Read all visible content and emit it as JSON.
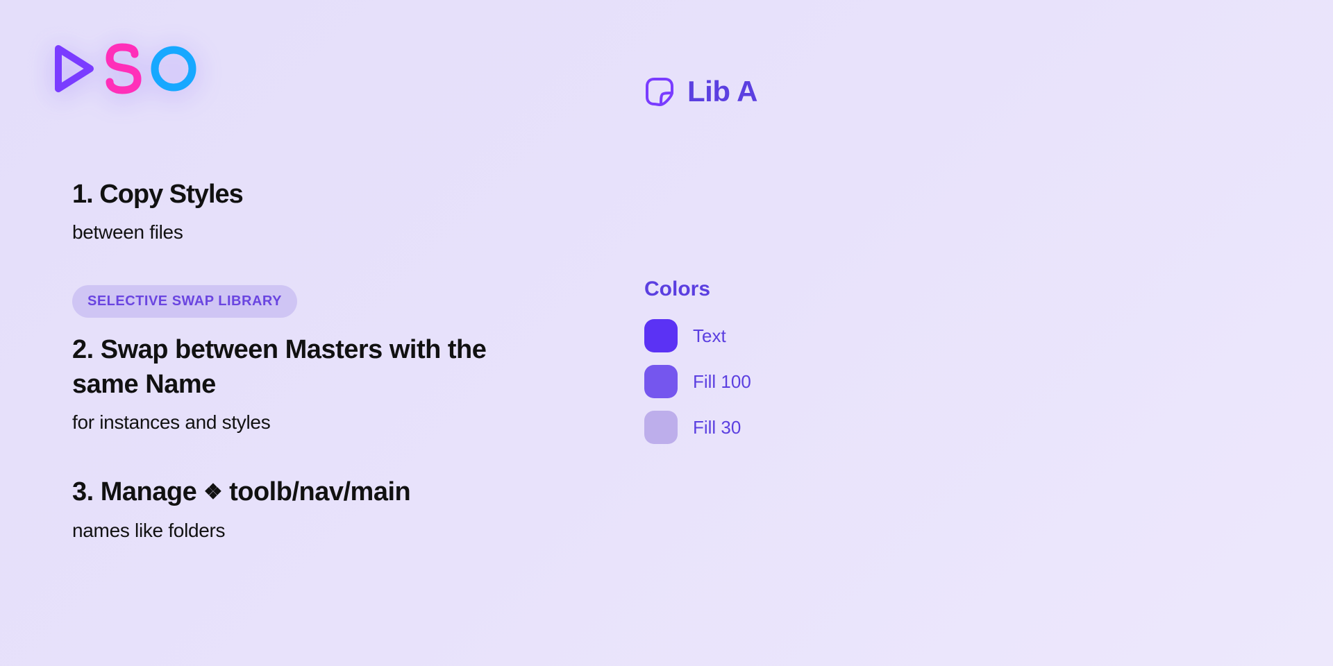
{
  "logo": {
    "name": "DSO"
  },
  "features": [
    {
      "title": "1. Copy Styles",
      "subtitle": "between files"
    },
    {
      "pill": "SELECTIVE SWAP LIBRARY",
      "title": "2. Swap between Masters with the same Name",
      "subtitle": "for instances and styles"
    },
    {
      "title_before": "3. Manage ",
      "title_after": " toolb/nav/main",
      "subtitle": "names like folders"
    }
  ],
  "library": {
    "title": "Lib A",
    "colors_heading": "Colors",
    "swatches": [
      {
        "name": "Text",
        "hex": "#5B32F4"
      },
      {
        "name": "Fill 100",
        "hex": "#7556EE"
      },
      {
        "name": "Fill 30",
        "hex": "#BDAEEB"
      }
    ]
  }
}
